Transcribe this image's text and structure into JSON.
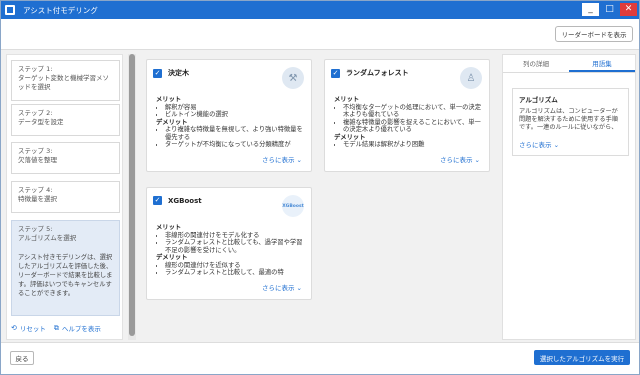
{
  "window": {
    "title": "アシスト付モデリング",
    "minimize_glyph": "_",
    "maximize_glyph": "□",
    "close_glyph": "✕"
  },
  "toolbar": {
    "leaderboard_label": "リーダーボードを表示"
  },
  "steps": [
    {
      "label": "ステップ 1:",
      "text": "ターゲット変数と機械学習メソッドを選択"
    },
    {
      "label": "ステップ 2:",
      "text": "データ型を設定"
    },
    {
      "label": "ステップ 3:",
      "text": "欠落値を整理"
    },
    {
      "label": "ステップ 4:",
      "text": "特徴量を選択"
    },
    {
      "label": "ステップ 5:",
      "text": "アルゴリズムを選択",
      "description": "アシスト付きモデリングは、選択したアルゴリズムを評価した後、リーダーボードで結果を比較します。評価はいつでもキャンセルすることができます。"
    }
  ],
  "links": {
    "reset": "リセット",
    "help": "ヘルプを表示"
  },
  "cards": [
    {
      "title": "決定木",
      "icon": "decision-tree-icon",
      "merits_title": "メリット",
      "merits": [
        "解釈が容易",
        "ビルトイン機能の選択"
      ],
      "demerits_title": "デメリット",
      "demerits": [
        "より複雑な特徴量を無視して、より強い特徴量を優先する",
        "ターゲットが不均衡になっている分類精度が"
      ],
      "more": "さらに表示"
    },
    {
      "title": "ランダムフォレスト",
      "icon": "random-forest-icon",
      "merits_title": "メリット",
      "merits": [
        "不均衡なターゲットの処理において、単一の決定木よりも優れている",
        "複雑な特徴量の影響を捉えることにおいて、単一の決定木より優れている"
      ],
      "demerits_title": "デメリット",
      "demerits": [
        "モデル結果は解釈がより困難"
      ],
      "more": "さらに表示"
    },
    {
      "title": "XGBoost",
      "icon": "xgboost-logo-icon",
      "logo_text": "XGBoost",
      "merits_title": "メリット",
      "merits": [
        "非線形の関連付けをモデル化する",
        "ランダムフォレストと比較しても、過学習や学習不足の影響を受けにくい。"
      ],
      "demerits_title": "デメリット",
      "demerits": [
        "線形の関連付けを近似する",
        "ランダムフォレストと比較して、最適の特"
      ],
      "more": "さらに表示"
    }
  ],
  "right_panel": {
    "tabs": [
      "列の詳細",
      "用語集"
    ],
    "active_tab": 1,
    "glossary": {
      "title": "アルゴリズム",
      "text": "アルゴリズムは、コンピューターが問題を解決するために使用する手順です。一連のルールに従いながら、",
      "more": "さらに表示"
    }
  },
  "footer": {
    "back_label": "戻る",
    "run_label": "選択したアルゴリズムを実行"
  },
  "colors": {
    "accent": "#1f6fd1",
    "close": "#e03c3c",
    "active_step": "#e3ebf6"
  }
}
